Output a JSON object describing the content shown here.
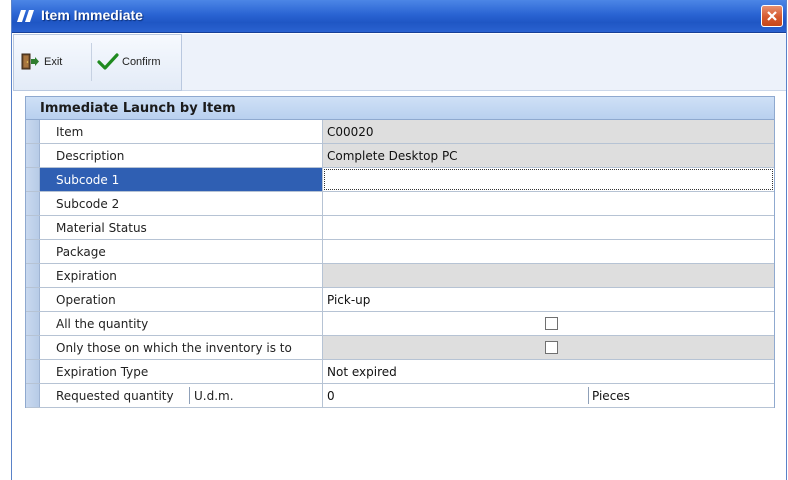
{
  "window": {
    "title": "Item Immediate",
    "accent_color": "#2a64d3",
    "close_icon": "close-icon"
  },
  "toolbar": {
    "exit_label": "Exit",
    "confirm_label": "Confirm"
  },
  "panel": {
    "title": "Immediate Launch by Item"
  },
  "fields": {
    "item": {
      "label": "Item",
      "value": "C00020"
    },
    "description": {
      "label": "Description",
      "value": "Complete Desktop PC"
    },
    "subcode1": {
      "label": "Subcode 1",
      "value": ""
    },
    "subcode2": {
      "label": "Subcode 2",
      "value": ""
    },
    "material_status": {
      "label": "Material Status",
      "value": ""
    },
    "package": {
      "label": "Package",
      "value": ""
    },
    "expiration": {
      "label": "Expiration",
      "value": ""
    },
    "operation": {
      "label": "Operation",
      "value": "Pick-up"
    },
    "all_quantity": {
      "label": "All the quantity",
      "checked": false
    },
    "only_inventory": {
      "label": "Only those on which the inventory is to",
      "checked": false
    },
    "expiration_type": {
      "label": "Expiration Type",
      "value": "Not expired"
    },
    "requested_quantity": {
      "label": "Requested quantity",
      "udm_label": "U.d.m.",
      "value": "0",
      "unit": "Pieces"
    }
  }
}
